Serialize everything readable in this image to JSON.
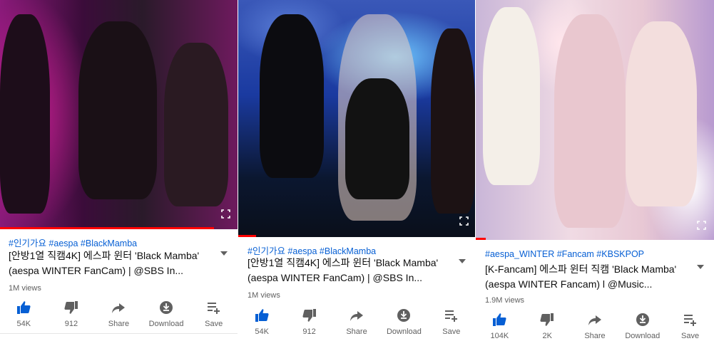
{
  "colors": {
    "link": "#065fd4",
    "progress": "#ff0000",
    "icon_active": "#065fd4",
    "icon_inactive": "#606060"
  },
  "panels": [
    {
      "tags": "#인기가요 #aespa #BlackMamba",
      "title": "[안방1열 직캠4K] 에스파 윈터 'Black Mamba' (aespa WINTER FanCam) | @SBS In...",
      "views": "1M views",
      "actions": [
        {
          "icon": "thumbs-up-icon",
          "label": "54K"
        },
        {
          "icon": "thumbs-down-icon",
          "label": "912"
        },
        {
          "icon": "share-icon",
          "label": "Share"
        },
        {
          "icon": "download-icon",
          "label": "Download"
        },
        {
          "icon": "save-icon",
          "label": "Save"
        }
      ]
    },
    {
      "tags": "#인기가요 #aespa #BlackMamba",
      "title": "[안방1열 직캠4K] 에스파 윈터 'Black Mamba' (aespa WINTER FanCam) | @SBS In...",
      "views": "1M views",
      "actions": [
        {
          "icon": "thumbs-up-icon",
          "label": "54K"
        },
        {
          "icon": "thumbs-down-icon",
          "label": "912"
        },
        {
          "icon": "share-icon",
          "label": "Share"
        },
        {
          "icon": "download-icon",
          "label": "Download"
        },
        {
          "icon": "save-icon",
          "label": "Save"
        }
      ]
    },
    {
      "tags": "#aespa_WINTER #Fancam #KBSKPOP",
      "title": "[K-Fancam] 에스파 윈터 직캠 'Black Mamba' (aespa WINTER Fancam) l @Music...",
      "views": "1.9M views",
      "actions": [
        {
          "icon": "thumbs-up-icon",
          "label": "104K"
        },
        {
          "icon": "thumbs-down-icon",
          "label": "2K"
        },
        {
          "icon": "share-icon",
          "label": "Share"
        },
        {
          "icon": "download-icon",
          "label": "Download"
        },
        {
          "icon": "save-icon",
          "label": "Save"
        }
      ]
    }
  ]
}
